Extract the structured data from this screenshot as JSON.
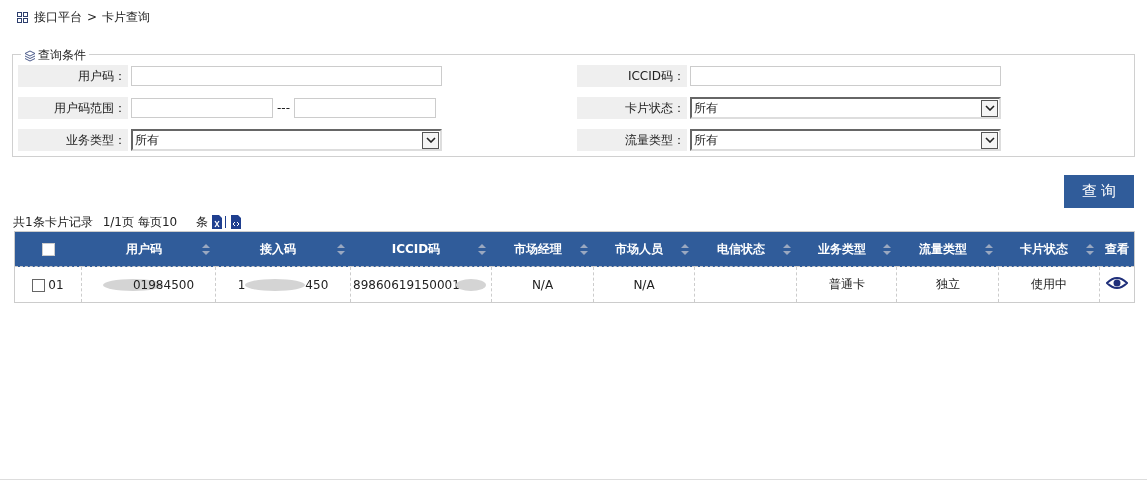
{
  "breadcrumb": {
    "items": [
      "接口平台",
      "卡片查询"
    ],
    "separator": ">"
  },
  "filter": {
    "legend": "查询条件",
    "fields": [
      {
        "label": "用户码：",
        "kind": "text"
      },
      {
        "label": "ICCID码：",
        "kind": "text"
      },
      {
        "label": "用户码范围：",
        "kind": "range",
        "separator": "---"
      },
      {
        "label": "卡片状态：",
        "kind": "select",
        "value": "所有"
      },
      {
        "label": "业务类型：",
        "kind": "select",
        "value": "所有"
      },
      {
        "label": "流量类型：",
        "kind": "select",
        "value": "所有"
      }
    ],
    "search_button": "查 询"
  },
  "summary": {
    "total": "共1条卡片记录",
    "pages": "1/1页",
    "per_page_label": "每页10",
    "unit": "条"
  },
  "table": {
    "select_all": {
      "checked": false
    },
    "columns": [
      {
        "label": "用户码",
        "sortable": true
      },
      {
        "label": "接入码",
        "sortable": true
      },
      {
        "label": "ICCID码",
        "sortable": true
      },
      {
        "label": "市场经理",
        "sortable": true
      },
      {
        "label": "市场人员",
        "sortable": true
      },
      {
        "label": "电信状态",
        "sortable": true
      },
      {
        "label": "业务类型",
        "sortable": true
      },
      {
        "label": "流量类型",
        "sortable": true
      },
      {
        "label": "卡片状态",
        "sortable": true
      },
      {
        "label": "查看",
        "sortable": false
      }
    ],
    "rows": [
      {
        "checked": false,
        "index": "01",
        "cells": [
          {
            "text": "01984500",
            "kind": "blurleft"
          },
          {
            "text": "1",
            "text_end": "450",
            "kind": "blurmiddle"
          },
          {
            "text": "89860619150001",
            "kind": "blurright"
          },
          {
            "text": "N/A"
          },
          {
            "text": "N/A"
          },
          {
            "text": ""
          },
          {
            "text": "普通卡"
          },
          {
            "text": "独立"
          },
          {
            "text": "使用中"
          }
        ]
      }
    ]
  }
}
